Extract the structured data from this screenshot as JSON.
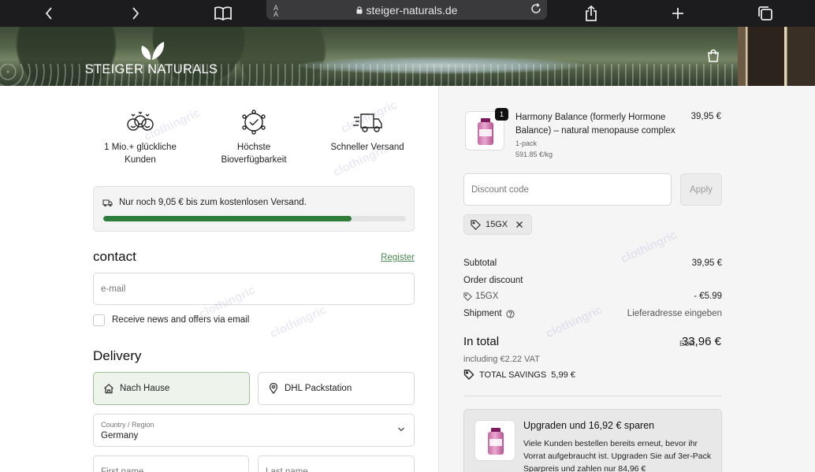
{
  "browser": {
    "url": "steiger-naturals.de",
    "aa_label": "A A"
  },
  "header": {
    "brand": "STEIGER NATURALS"
  },
  "usps": [
    {
      "icon": "smiley-faces-icon",
      "text": "1 Mio.+ glückliche Kunden"
    },
    {
      "icon": "atom-check-icon",
      "text": "Höchste Bioverfügbarkeit"
    },
    {
      "icon": "fast-truck-icon",
      "text": "Schneller Versand"
    }
  ],
  "shipping_progress": {
    "text": "Nur noch 9,05 € bis zum kostenlosen Versand.",
    "fraction": 0.82
  },
  "contact": {
    "title": "contact",
    "register_link": "Register",
    "email_placeholder": "e-mail",
    "newsletter_label": "Receive news and offers via email"
  },
  "delivery": {
    "title": "Delivery",
    "option_home": "Nach Hause",
    "option_packstation": "DHL Packstation",
    "country_label": "Country / Region",
    "country_value": "Germany",
    "first_name_placeholder": "First name",
    "last_name_placeholder": "Last name"
  },
  "order": {
    "product": {
      "name": "Harmony Balance (formerly Hormone Balance) – natural menopause complex",
      "variant": "1-pack",
      "unit_price": "591.85 €/kg",
      "price": "39,95 €",
      "quantity": "1"
    },
    "discount_placeholder": "Discount code",
    "apply_label": "Apply",
    "applied_code": "15GX",
    "subtotal_label": "Subtotal",
    "subtotal_value": "39,95 €",
    "order_discount_label": "Order discount",
    "discount_code": "15GX",
    "discount_value": "- €5.99",
    "shipment_label": "Shipment",
    "shipment_value": "Lieferadresse eingeben",
    "total_label": "In total",
    "currency": "EUR",
    "total_value": "33,96 €",
    "vat": "including €2.22 VAT",
    "savings": "TOTAL SAVINGS  5,99 €"
  },
  "upsell": {
    "title": "Upgraden und 16,92 € sparen",
    "description": "Viele Kunden bestellen bereits erneut, bevor ihr Vorrat aufgebraucht ist. Upgraden Sie auf 3er-Pack Sparpreis und zahlen nur 84,96 €"
  },
  "watermark": "clothingric"
}
